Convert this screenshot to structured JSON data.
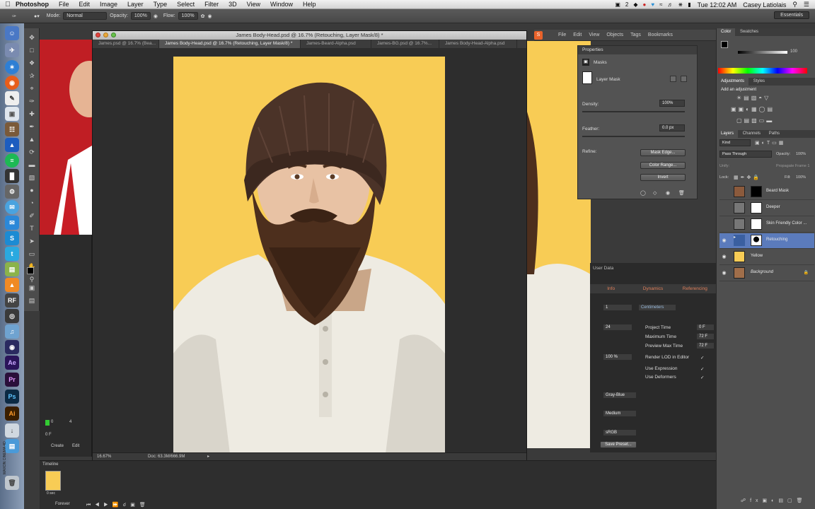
{
  "menubar": {
    "app": "Photoshop",
    "items": [
      "File",
      "Edit",
      "Image",
      "Layer",
      "Type",
      "Select",
      "Filter",
      "3D",
      "View",
      "Window",
      "Help"
    ],
    "clock": "Tue 12:02 AM",
    "user": "Casey Latiolais",
    "tray_count": "2"
  },
  "options": {
    "mode_label": "Mode:",
    "mode_value": "Normal",
    "opacity_label": "Opacity:",
    "opacity_value": "100%",
    "flow_label": "Flow:",
    "flow_value": "100%",
    "workspace": "Essentials"
  },
  "document": {
    "title": "James Body-Head.psd @ 16.7% (Retouching, Layer Mask/8) *",
    "tabs": [
      "James.psd @ 16.7% (Bea...",
      "James Body-Head.psd @ 16.7% (Retouching, Layer Mask/8) *",
      "James-Beard-Alpha.psd",
      "James-BG.psd @ 16.7%...",
      "James Body-Head-Alpha.psd"
    ],
    "zoom": "16.67%",
    "doc_size": "Doc: 63.3M/666.9M"
  },
  "bridge_menu": [
    "File",
    "Edit",
    "View",
    "Objects",
    "Tags",
    "Bookmarks"
  ],
  "properties": {
    "panel_title": "Properties",
    "section": "Masks",
    "mask_type": "Layer Mask",
    "density_label": "Density:",
    "density_value": "100%",
    "feather_label": "Feather:",
    "feather_value": "0.0 px",
    "refine_label": "Refine:",
    "buttons": [
      "Mask Edge...",
      "Color Range...",
      "Invert"
    ]
  },
  "c4d": {
    "header": "User Data",
    "tabs": [
      "Info",
      "Dynamics",
      "Referencing"
    ],
    "units": "Centimeters",
    "frame_value": "1",
    "fps_value": "24",
    "rows": [
      {
        "label": "Project Time",
        "value": "0 F"
      },
      {
        "label": "Maximum Time",
        "value": "72 F"
      },
      {
        "label": "Preview Max Time",
        "value": "72 F"
      },
      {
        "label": "Render LOD in Editor",
        "value": ""
      },
      {
        "label": "Use Expression",
        "value": ""
      },
      {
        "label": "Use Deformers",
        "value": ""
      }
    ],
    "lod": "100 %",
    "color_value": "Gray-Blue",
    "quality": "Medium",
    "profile": "sRGB",
    "save_button": "Save Preset..."
  },
  "color_panel": {
    "tabs": [
      "Color",
      "Swatches"
    ],
    "value": "100"
  },
  "adjustments": {
    "tabs": [
      "Adjustments",
      "Styles"
    ],
    "hint": "Add an adjustment"
  },
  "layers_panel": {
    "tabs": [
      "Layers",
      "Channels",
      "Paths"
    ],
    "kind": "Kind",
    "blend": "Pass Through",
    "opacity_label": "Opacity:",
    "opacity_value": "100%",
    "fill_label": "Fill:",
    "fill_value": "100%",
    "lock_label": "Lock:",
    "unify_label": "Unify:",
    "propagate_label": "Propagate Frame 1",
    "layers": [
      {
        "name": "Beard Mask",
        "visible": false
      },
      {
        "name": "Deeper",
        "visible": false
      },
      {
        "name": "Skin Friendly Color ...",
        "visible": false
      },
      {
        "name": "Retouching",
        "visible": true
      },
      {
        "name": "Yellow",
        "visible": true
      },
      {
        "name": "Background",
        "visible": true
      }
    ]
  },
  "timeline": {
    "title": "Timeline",
    "frame": "0 sec",
    "loop": "Forever",
    "left_values": [
      "0",
      "4",
      "0 F"
    ],
    "create_label": "Create",
    "edit_label": "Edit"
  },
  "dock_labels": {
    "after_effects": "Ae",
    "premiere": "Pr",
    "photoshop": "Ps",
    "illustrator": "Ai",
    "c4d_brand": "MAXON CINEMA 4D"
  },
  "colors": {
    "canvas_bg": "#f8cc55",
    "selection": "#5b7bbc",
    "c4d_accent": "#e07f5a"
  }
}
